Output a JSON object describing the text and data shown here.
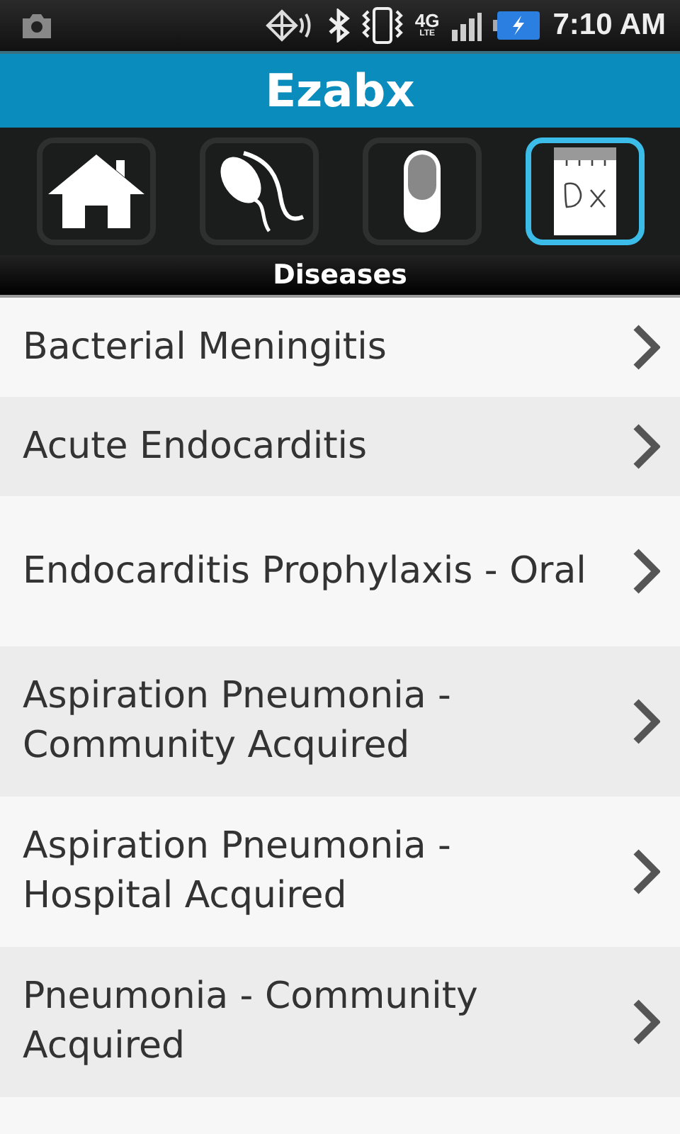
{
  "status_bar": {
    "network": "4G",
    "network_sub": "LTE",
    "time": "7:10 AM"
  },
  "header": {
    "title": "Ezabx"
  },
  "tabs": [
    {
      "kind": "home",
      "selected": false
    },
    {
      "kind": "microbe",
      "selected": false
    },
    {
      "kind": "pill",
      "selected": false
    },
    {
      "kind": "dx",
      "selected": true
    }
  ],
  "section_label": "Diseases",
  "diseases": [
    {
      "name": "Bacterial Meningitis"
    },
    {
      "name": "Acute Endocarditis"
    },
    {
      "name": "Endocarditis Prophylaxis - Oral"
    },
    {
      "name": "Aspiration Pneumonia - Community Acquired"
    },
    {
      "name": "Aspiration Pneumonia - Hospital Acquired"
    },
    {
      "name": "Pneumonia - Community Acquired"
    }
  ]
}
